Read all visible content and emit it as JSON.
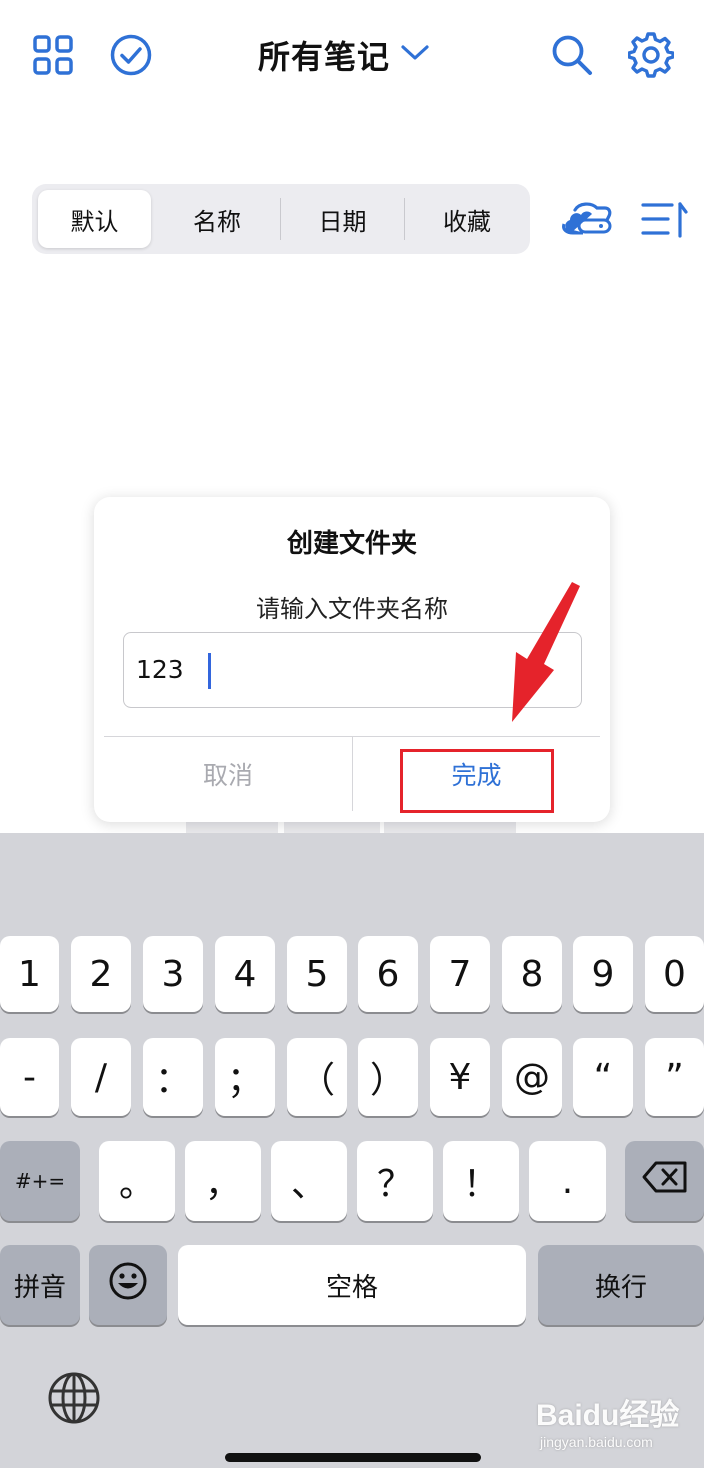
{
  "header": {
    "title": "所有笔记",
    "icons": [
      "grid-icon",
      "check-circle-icon",
      "chevron-down-icon",
      "search-icon",
      "gear-icon"
    ]
  },
  "sort_tabs": {
    "items": [
      "默认",
      "名称",
      "日期",
      "收藏"
    ],
    "selected": "默认"
  },
  "toolbar_icons": [
    "cloud-sync-icon",
    "sort-order-icon"
  ],
  "dialog": {
    "title": "创建文件夹",
    "subtitle": "请输入文件夹名称",
    "input_value": "123",
    "cancel_label": "取消",
    "done_label": "完成"
  },
  "keyboard": {
    "row1": [
      "1",
      "2",
      "3",
      "4",
      "5",
      "6",
      "7",
      "8",
      "9",
      "0"
    ],
    "row2": [
      "-",
      "/",
      "：",
      "；",
      "（",
      "）",
      "¥",
      "@",
      "“",
      "”"
    ],
    "row3_left": "#+=",
    "row3": [
      "。",
      "，",
      "、",
      "？",
      "！",
      "."
    ],
    "row4_left": "拼音",
    "space": "空格",
    "return": "换行"
  },
  "watermark": {
    "main": "Baidu经验",
    "sub": "jingyan.baidu.com"
  },
  "colors": {
    "accent": "#2f71d6",
    "highlight": "#e5232b",
    "keyboard_bg": "#d3d4d9"
  }
}
